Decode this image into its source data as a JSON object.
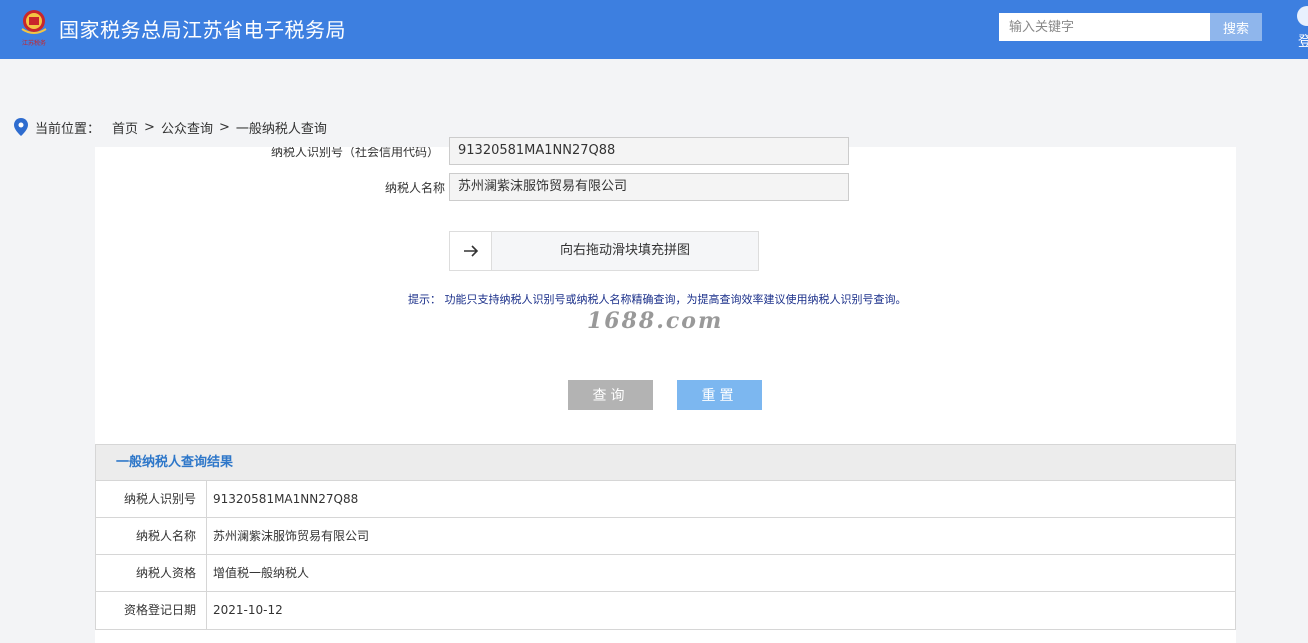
{
  "header": {
    "title": "国家税务总局江苏省电子税务局",
    "logo_text": "江苏税务",
    "search_placeholder": "输入关键字",
    "search_button": "搜索",
    "login_label": "登"
  },
  "breadcrumb": {
    "label": "当前位置：",
    "items": [
      "首页",
      "公众查询",
      "一般纳税人查询"
    ],
    "separator": ">"
  },
  "form": {
    "tax_id_label": "纳税人识别号（社会信用代码）",
    "tax_id_value": "91320581MA1NN27Q88",
    "name_label": "纳税人名称",
    "name_value": "苏州澜紫沫服饰贸易有限公司",
    "slider_text": "向右拖动滑块填充拼图",
    "hint": "提示：   功能只支持纳税人识别号或纳税人名称精确查询，为提高查询效率建议使用纳税人识别号查询。",
    "watermark": "1688.com",
    "query_button": "查询",
    "reset_button": "重置"
  },
  "results": {
    "title": "一般纳税人查询结果",
    "rows": [
      {
        "label": "纳税人识别号",
        "value": "91320581MA1NN27Q88"
      },
      {
        "label": "纳税人名称",
        "value": "苏州澜紫沫服饰贸易有限公司"
      },
      {
        "label": "纳税人资格",
        "value": "增值税一般纳税人"
      },
      {
        "label": "资格登记日期",
        "value": "2021-10-12"
      }
    ]
  },
  "colors": {
    "header_bg": "#3d7fe0",
    "result_title": "#2e77c9",
    "hint_text": "#1a2f8a",
    "query_button": "#b3b3b3",
    "reset_button": "#7cb7f0"
  }
}
